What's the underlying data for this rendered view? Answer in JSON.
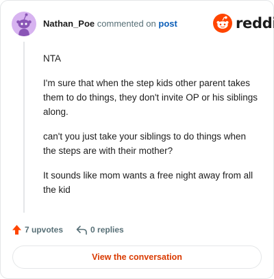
{
  "header": {
    "username": "Nathan_Poe",
    "action_text": "commented on",
    "post_link": "post",
    "brand": "reddit"
  },
  "comment": {
    "paragraphs": [
      "NTA",
      "I'm sure that when the step kids other parent takes them to do things, they don't invite OP or his siblings along.",
      "can't you just take your siblings to do things when the steps are with their mother?",
      "It sounds like mom wants a free night away from all the kid"
    ]
  },
  "actions": {
    "upvotes_label": "7 upvotes",
    "replies_label": "0 replies"
  },
  "footer": {
    "view_button_label": "View the conversation"
  },
  "colors": {
    "brand_orange": "#ff4500",
    "button_text": "#d93a00",
    "link_blue": "#0a5db8",
    "avatar_bg": "#d7b3f0"
  },
  "icons": {
    "avatar": "snoo-avatar-icon",
    "logo": "reddit-logo-icon",
    "upvote": "upvote-arrow-icon",
    "reply": "reply-arrow-icon"
  }
}
